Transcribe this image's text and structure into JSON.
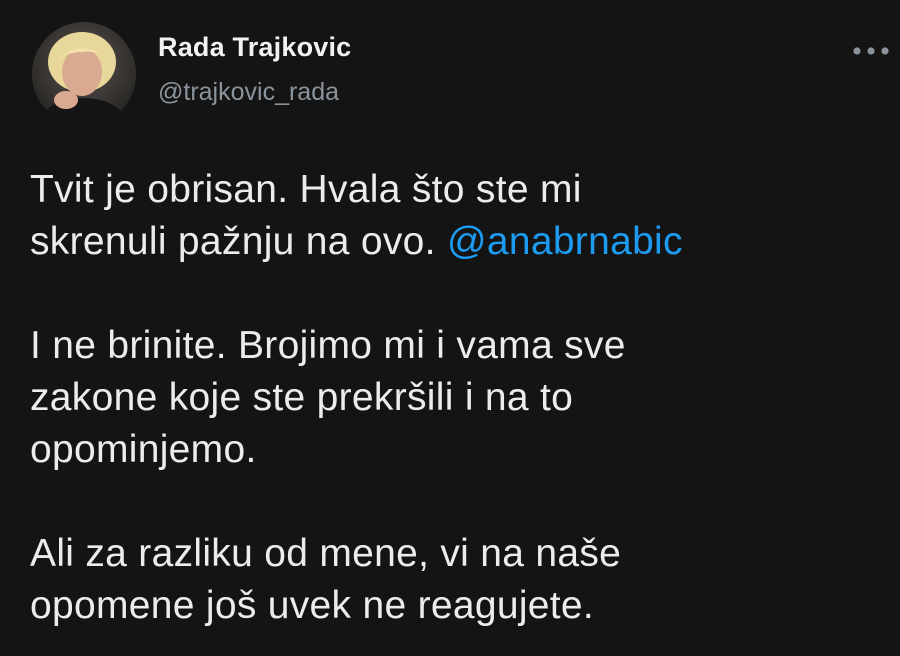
{
  "author": {
    "name": "Rada Trajkovic",
    "handle": "@trajkovic_rada"
  },
  "icons": {
    "avatar": "profile-photo",
    "more": "more-horizontal-icon"
  },
  "colors": {
    "background": "#141414",
    "text": "#ececec",
    "handle": "#8b949c",
    "mention": "#1d9bf0"
  },
  "tweet": {
    "p1": {
      "line1": "Tvit je obrisan. Hvala što ste mi",
      "line2_text": "skrenuli pažnju na ovo. ",
      "mention": "@anabrnabic"
    },
    "p2": {
      "line1": "I ne brinite. Brojimo mi i vama sve",
      "line2": "zakone koje ste prekršili i na to",
      "line3": "opominjemo."
    },
    "p3": {
      "line1": "Ali za razliku od mene, vi na naše",
      "line2": "opomene još uvek ne reagujete."
    }
  }
}
